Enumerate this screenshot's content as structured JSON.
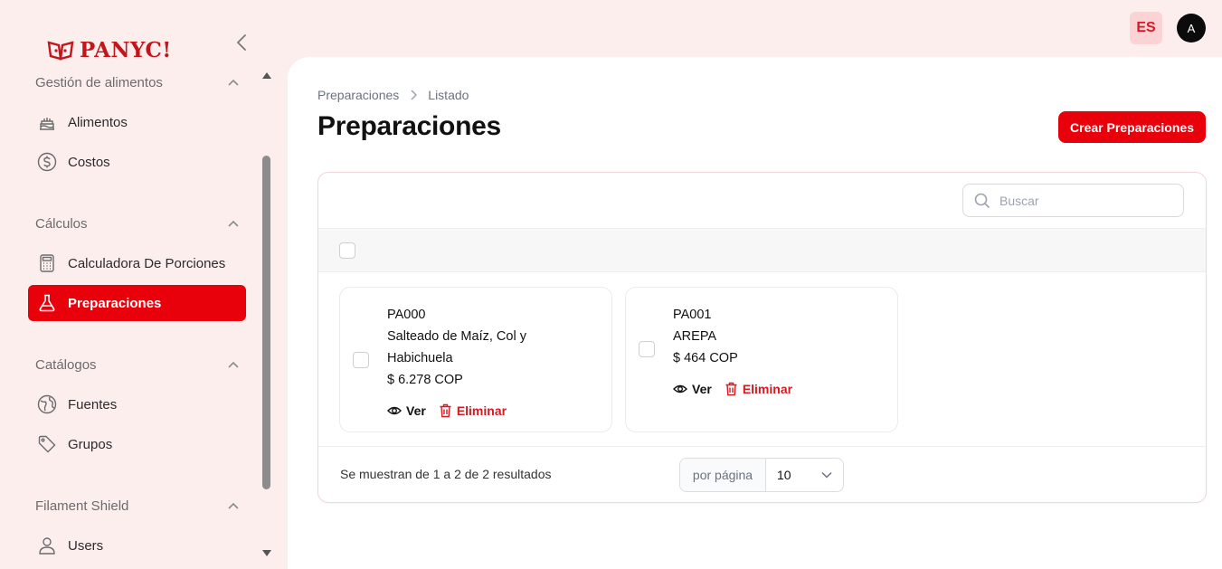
{
  "app": {
    "logo_text": "PANYC!",
    "brand_color": "#e8000b"
  },
  "header": {
    "language": "ES",
    "avatar_initial": "A"
  },
  "sidebar": {
    "groups": [
      {
        "label": "Gestión de alimentos",
        "items": [
          {
            "label": "Alimentos",
            "icon": "cake-icon"
          },
          {
            "label": "Costos",
            "icon": "dollar-circle-icon"
          }
        ]
      },
      {
        "label": "Cálculos",
        "items": [
          {
            "label": "Calculadora De Porciones",
            "icon": "calculator-icon"
          },
          {
            "label": "Preparaciones",
            "icon": "flask-icon",
            "active": true
          }
        ]
      },
      {
        "label": "Catálogos",
        "items": [
          {
            "label": "Fuentes",
            "icon": "globe-icon"
          },
          {
            "label": "Grupos",
            "icon": "tag-icon"
          }
        ]
      },
      {
        "label": "Filament Shield",
        "items": [
          {
            "label": "Users",
            "icon": "user-icon"
          }
        ]
      }
    ]
  },
  "main": {
    "breadcrumb": [
      "Preparaciones",
      "Listado"
    ],
    "title": "Preparaciones",
    "create_button": "Crear Preparaciones",
    "search": {
      "placeholder": "Buscar",
      "value": ""
    },
    "records": [
      {
        "code": "PA000",
        "name_line1": "Salteado de Maíz, Col y",
        "name_line2": "Habichuela",
        "price": "$ 6.278 COP",
        "view_label": "Ver",
        "delete_label": "Eliminar"
      },
      {
        "code": "PA001",
        "name_line1": "AREPA",
        "price": "$ 464 COP",
        "view_label": "Ver",
        "delete_label": "Eliminar"
      }
    ],
    "pagination": {
      "summary": "Se muestran de 1 a 2 de 2 resultados",
      "per_page_label": "por página",
      "per_page_value": "10"
    }
  }
}
